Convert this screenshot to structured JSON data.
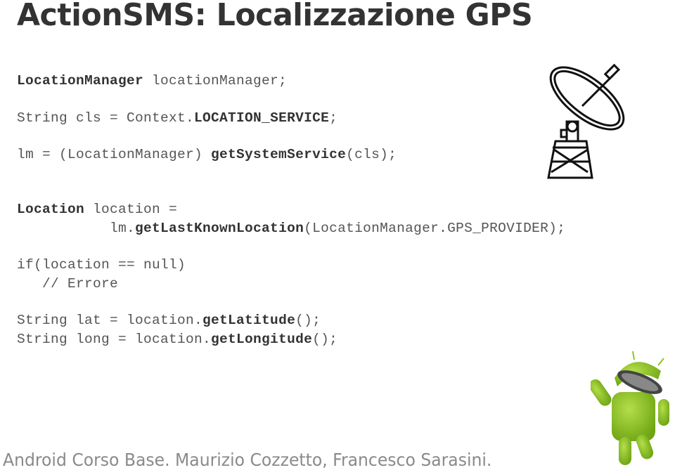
{
  "slide": {
    "title": "ActionSMS: Localizzazione GPS",
    "code_lines": [
      {
        "segments": [
          {
            "text": "LocationManager",
            "bold": true
          },
          {
            "text": " locationManager;",
            "bold": false
          }
        ]
      },
      {
        "segments": [
          {
            "text": "String cls = Context.",
            "bold": false
          },
          {
            "text": "LOCATION_SERVICE",
            "bold": true
          },
          {
            "text": ";",
            "bold": false
          }
        ]
      },
      {
        "segments": [
          {
            "text": "lm = (LocationManager) ",
            "bold": false
          },
          {
            "text": "getSystemService",
            "bold": true
          },
          {
            "text": "(cls);",
            "bold": false
          }
        ]
      },
      {
        "segments": [
          {
            "text": "Location",
            "bold": true
          },
          {
            "text": " location =",
            "bold": false
          }
        ]
      },
      {
        "segments": [
          {
            "text": "           lm.",
            "bold": false
          },
          {
            "text": "getLastKnownLocation",
            "bold": true
          },
          {
            "text": "(LocationManager.GPS_PROVIDER);",
            "bold": false
          }
        ]
      },
      {
        "segments": [
          {
            "text": "if(location == null)",
            "bold": false
          }
        ]
      },
      {
        "segments": [
          {
            "text": "   // Errore",
            "bold": false
          }
        ]
      },
      {
        "segments": [
          {
            "text": "String lat = location.",
            "bold": false
          },
          {
            "text": "getLatitude",
            "bold": true
          },
          {
            "text": "();",
            "bold": false
          }
        ]
      },
      {
        "segments": [
          {
            "text": "String long = location.",
            "bold": false
          },
          {
            "text": "getLongitude",
            "bold": true
          },
          {
            "text": "();",
            "bold": false
          }
        ]
      }
    ],
    "footer": "Android Corso Base. Maurizio Cozzetto, Francesco Sarasini.",
    "images": {
      "satellite": "satellite-dish-icon",
      "android": "android-mascot-icon"
    },
    "colors": {
      "title": "#333333",
      "code": "#555555",
      "footer": "#8a8a8a",
      "android_green": "#8fc31f"
    }
  }
}
